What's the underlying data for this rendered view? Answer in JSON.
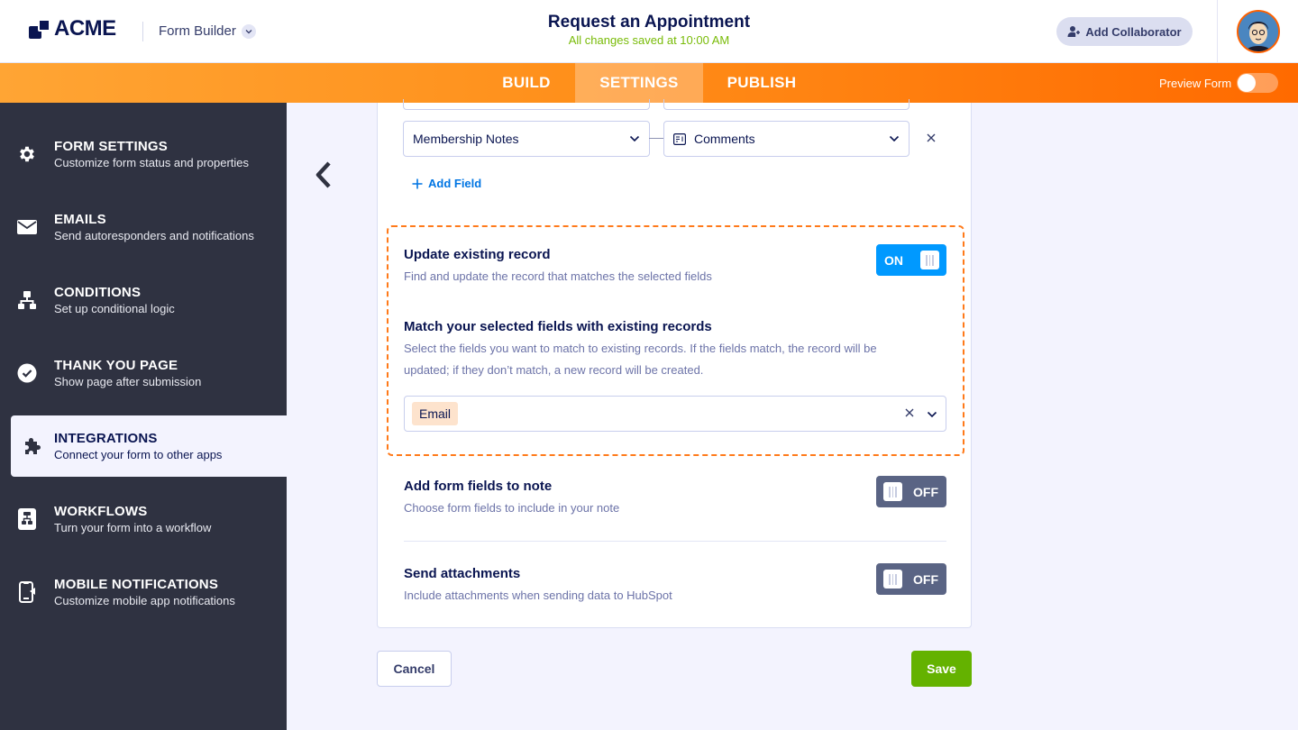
{
  "header": {
    "logo": "ACME",
    "app_name": "Form Builder",
    "form_title": "Request an Appointment",
    "save_status": "All changes saved at 10:00 AM",
    "add_collaborator": "Add Collaborator"
  },
  "tabs": [
    {
      "label": "BUILD",
      "active": false
    },
    {
      "label": "SETTINGS",
      "active": true
    },
    {
      "label": "PUBLISH",
      "active": false
    }
  ],
  "preview": {
    "label": "Preview Form",
    "enabled": false
  },
  "sidebar": {
    "items": [
      {
        "title": "FORM SETTINGS",
        "desc": "Customize form status and properties",
        "icon": "gear-icon"
      },
      {
        "title": "EMAILS",
        "desc": "Send autoresponders and notifications",
        "icon": "envelope-icon"
      },
      {
        "title": "CONDITIONS",
        "desc": "Set up conditional logic",
        "icon": "sitemap-icon"
      },
      {
        "title": "THANK YOU PAGE",
        "desc": "Show page after submission",
        "icon": "check-circle-icon"
      },
      {
        "title": "INTEGRATIONS",
        "desc": "Connect your form to other apps",
        "icon": "puzzle-icon",
        "active": true
      },
      {
        "title": "WORKFLOWS",
        "desc": "Turn your form into a workflow",
        "icon": "workflow-icon"
      },
      {
        "title": "MOBILE NOTIFICATIONS",
        "desc": "Customize mobile app notifications",
        "icon": "mobile-icon"
      }
    ]
  },
  "mapping": {
    "hubspot_field": "Membership Notes",
    "form_field": "Comments",
    "form_field_icon": "textarea-icon",
    "add_field": "Add Field"
  },
  "update_record": {
    "title": "Update existing record",
    "desc": "Find and update the record that matches the selected fields",
    "toggle": "ON",
    "match_title": "Match your selected fields with existing records",
    "match_desc_1": "Select the fields you want to match to existing records. If the fields match, the record will be",
    "match_desc_2": "updated; if they don’t match, a new record will be created.",
    "selected_tag": "Email"
  },
  "add_note": {
    "title": "Add form fields to note",
    "desc": "Choose form fields to include in your note",
    "toggle": "OFF"
  },
  "attachments": {
    "title": "Send attachments",
    "desc": "Include attachments when sending data to HubSpot",
    "toggle": "OFF"
  },
  "actions": {
    "cancel": "Cancel",
    "save": "Save"
  },
  "colors": {
    "navy": "#0a1551",
    "orange": "#ff6100",
    "blue": "#0099ff",
    "green": "#64b200",
    "sidebar": "#2f3241"
  }
}
